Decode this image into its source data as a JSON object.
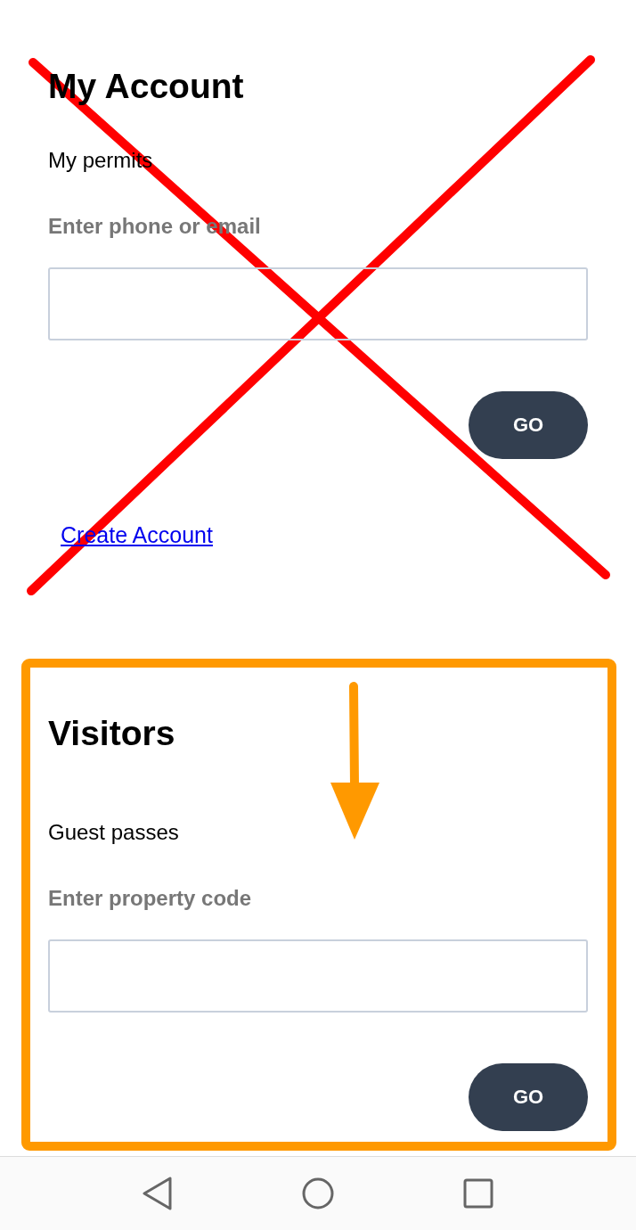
{
  "sections": [
    {
      "kind": "account",
      "title": "My Account",
      "subtitle": "My permits",
      "field_label": "Enter phone or email",
      "button": "GO",
      "link": "Create Account"
    },
    {
      "kind": "visitors",
      "title": "Visitors",
      "subtitle": "Guest passes",
      "field_label": "Enter property code",
      "button": "GO"
    }
  ]
}
